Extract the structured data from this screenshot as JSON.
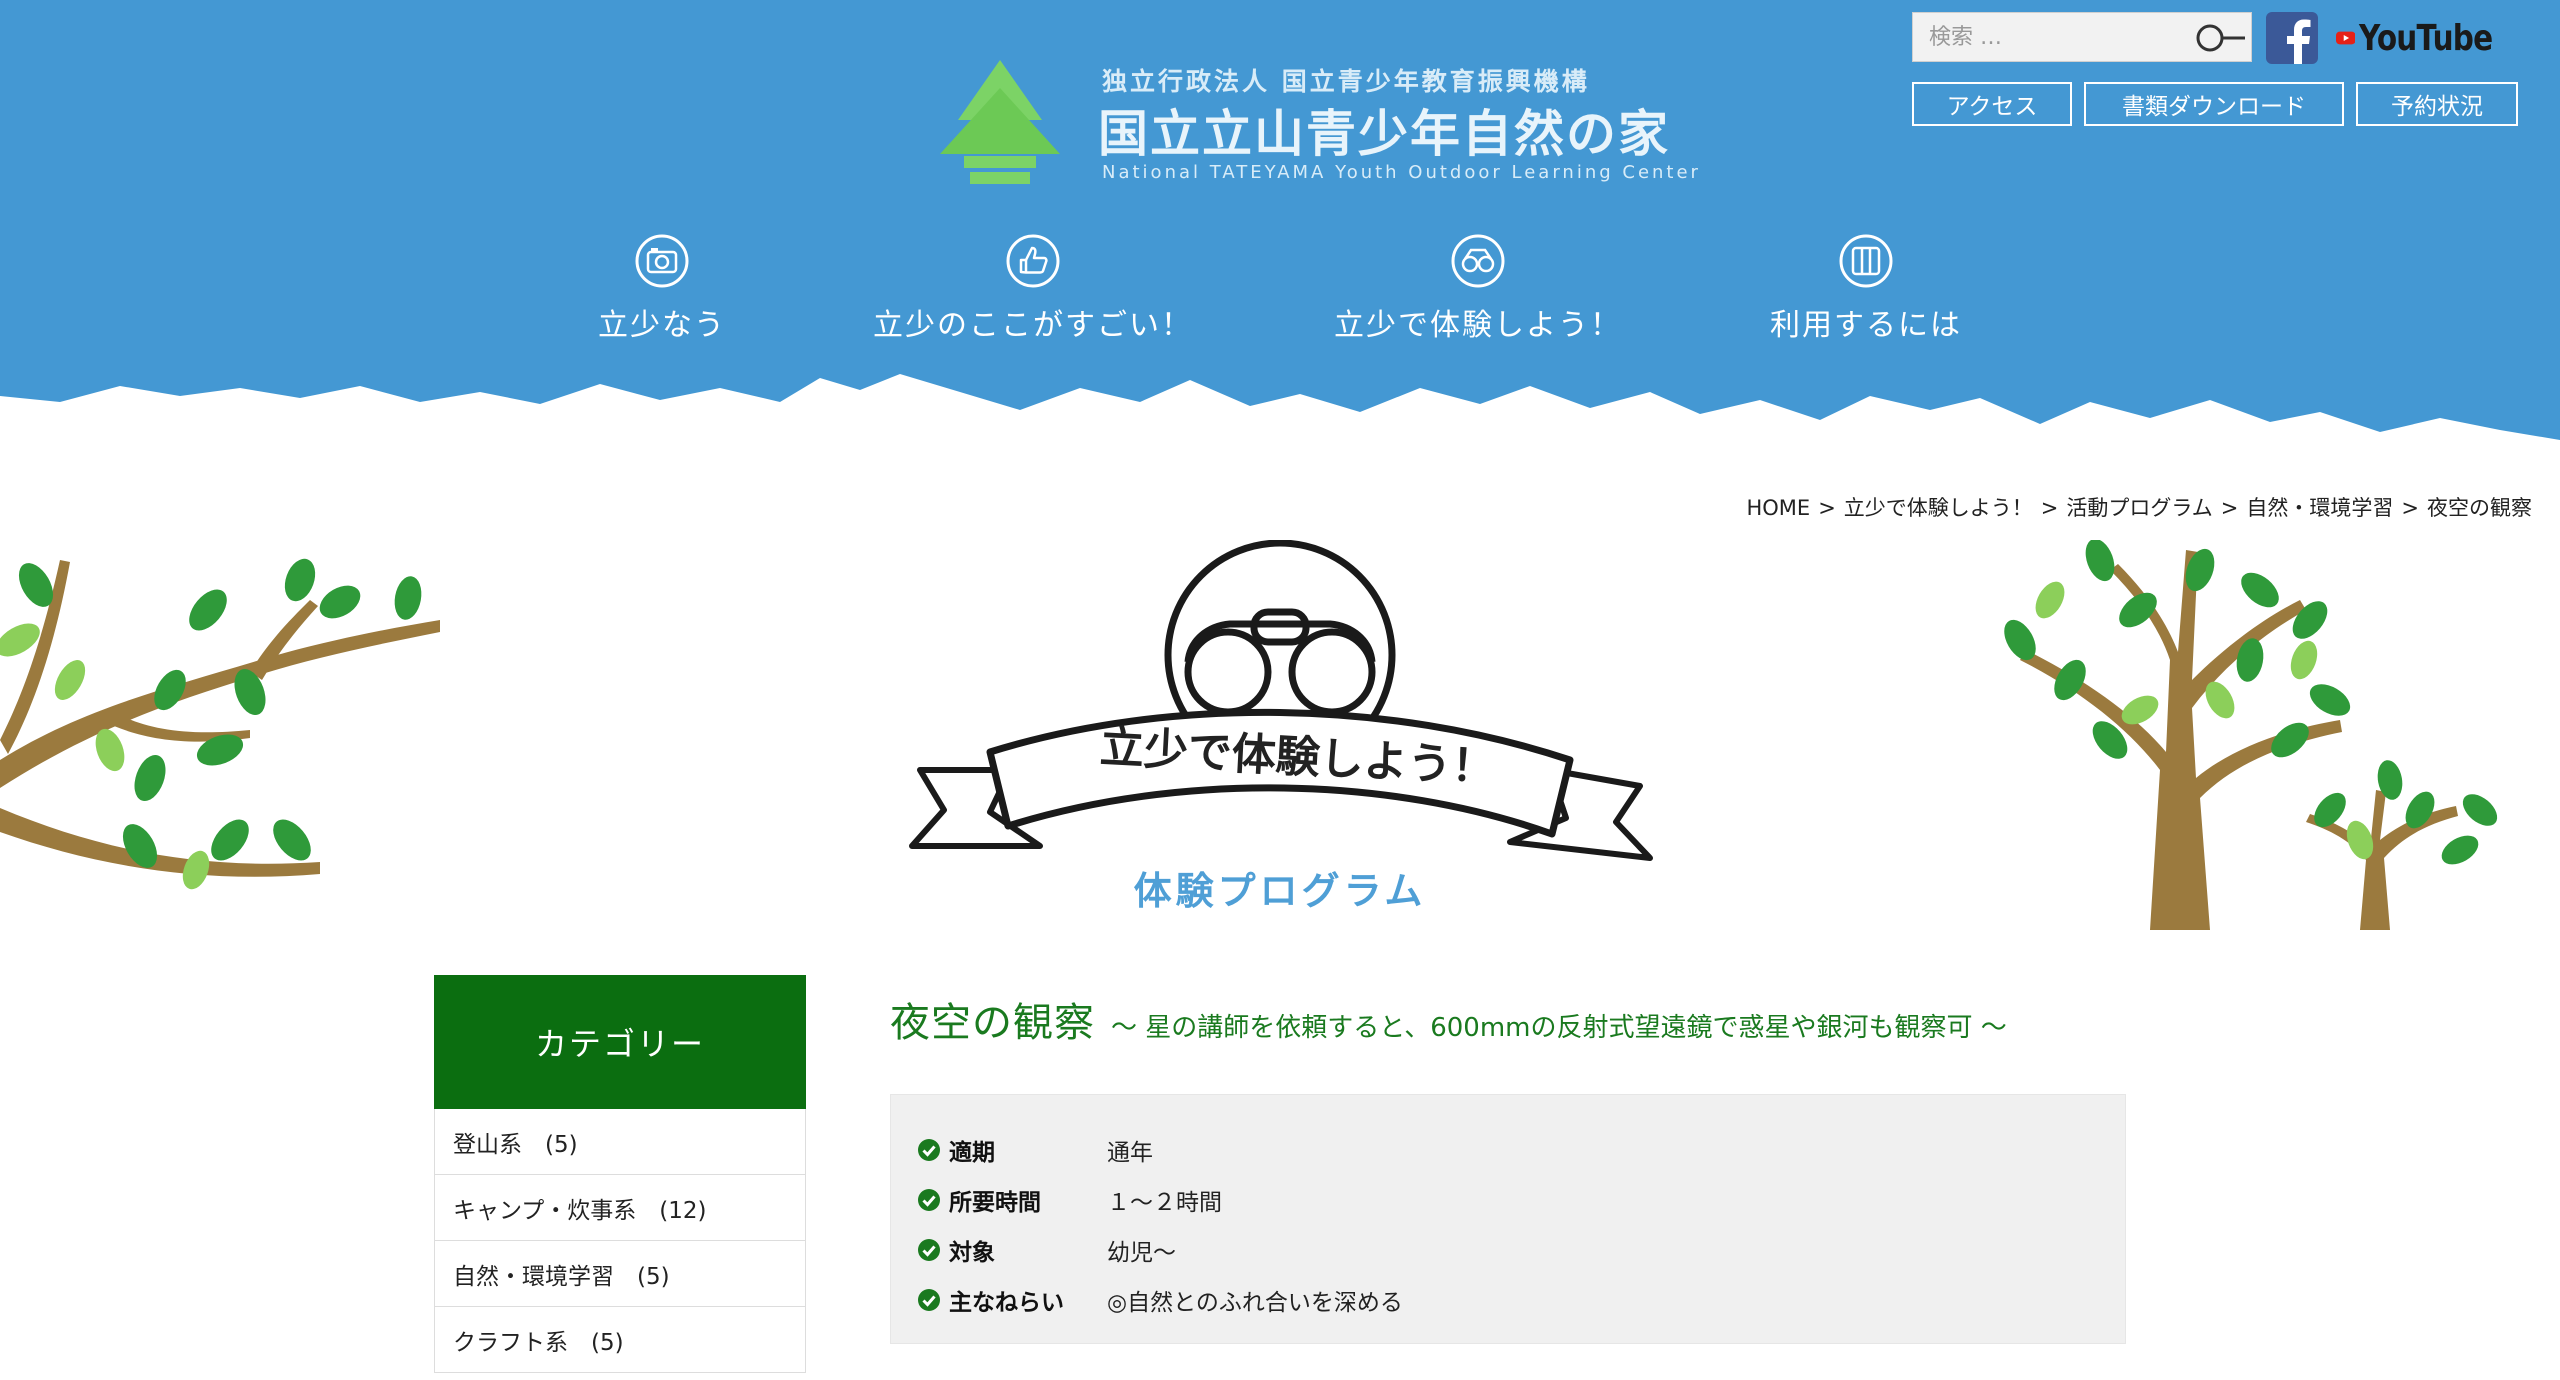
{
  "header": {
    "org": "独立行政法人 国立青少年教育振興機構",
    "name": "国立立山青少年自然の家",
    "name_en": "National TATEYAMA Youth Outdoor Learning Center"
  },
  "search": {
    "placeholder": "検索 …"
  },
  "social": {
    "youtube_label": "YouTube"
  },
  "utility_buttons": {
    "access": "アクセス",
    "download": "書類ダウンロード",
    "reservation": "予約状況"
  },
  "nav": [
    {
      "label": "立少なう",
      "icon": "camera-icon"
    },
    {
      "label": "立少のここがすごい！",
      "icon": "thumbs-up-icon"
    },
    {
      "label": "立少で体験しよう！",
      "icon": "binoculars-icon"
    },
    {
      "label": "利用するには",
      "icon": "info-icon"
    }
  ],
  "breadcrumb": [
    "HOME",
    "立少で体験しよう！",
    "活動プログラム",
    "自然・環境学習",
    "夜空の観察"
  ],
  "breadcrumb_sep": ">",
  "hero": {
    "ribbon": "立少で体験しよう！",
    "subtitle": "体験プログラム"
  },
  "sidebar": {
    "title": "カテゴリー",
    "items": [
      {
        "label": "登山系　(5)"
      },
      {
        "label": "キャンプ・炊事系　(12)"
      },
      {
        "label": "自然・環境学習　(5)"
      },
      {
        "label": "クラフト系　(5)"
      }
    ]
  },
  "program": {
    "title": "夜空の観察",
    "subtitle": "～ 星の講師を依頼すると、600mmの反射式望遠鏡で惑星や銀河も観察可 ～",
    "info": [
      {
        "label": "適期",
        "value": "通年"
      },
      {
        "label": "所要時間",
        "value": "１～２時間"
      },
      {
        "label": "対象",
        "value": "幼児～"
      },
      {
        "label": "主なねらい",
        "value": "◎自然とのふれ合いを深める"
      }
    ]
  },
  "colors": {
    "header_blue": "#4498d3",
    "sidebar_green": "#0b6e10",
    "title_green": "#1a7a1f",
    "subtitle_blue": "#4f9fd6",
    "leaf_green": "#2f9a3a",
    "trunk_brown": "#9b7a3e"
  }
}
